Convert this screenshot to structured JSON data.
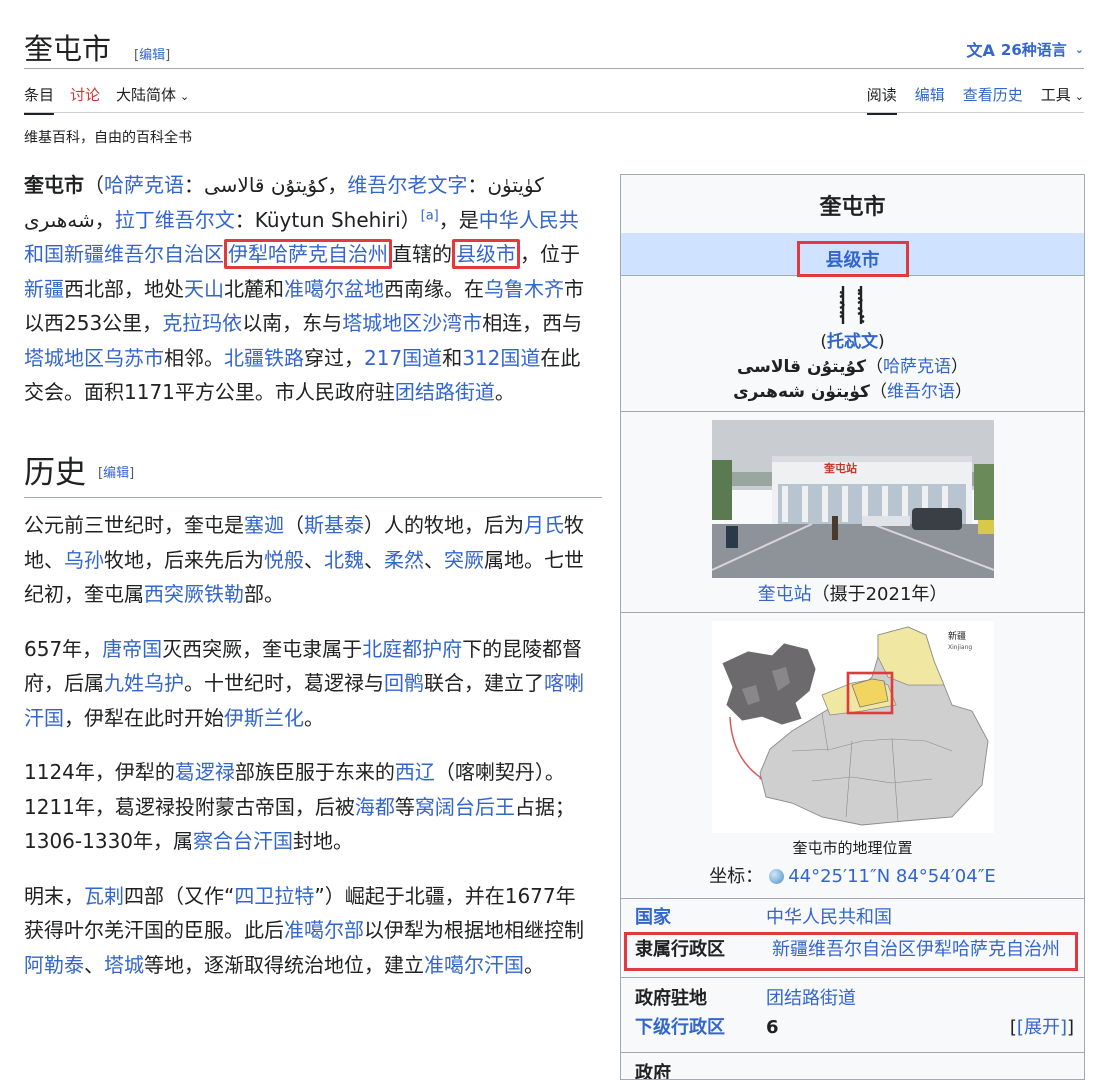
{
  "header": {
    "title": "奎屯市",
    "edit_label": "编辑",
    "languages_label": "26种语言",
    "lang_icon": "文A"
  },
  "tabs": {
    "article": "条目",
    "talk": "讨论",
    "variant": "大陆简体",
    "read": "阅读",
    "edit": "编辑",
    "history": "查看历史",
    "tools": "工具"
  },
  "tagline": "维基百科，自由的百科全书",
  "lead": {
    "name": "奎屯市",
    "lang1": "哈萨克语",
    "lang1_text": "كۇيتۇن قالاسى",
    "lang2": "维吾尔老文字",
    "lang2_text": "كۈيتۈن",
    "lang2_text_b": "شەھىرى",
    "lang3": "拉丁维吾尔文",
    "lang3_text": "Küytun Shehiri",
    "ref": "[a]",
    "link_prc_xinjiang": "中华人民共和国新疆维吾尔自治区",
    "link_ili": "伊犁哈萨克自治州",
    "text_direct": "直辖的",
    "link_county": "县级市",
    "text_located": "位于",
    "link_xinjiang": "新疆",
    "text_northwest": "西北部，地处",
    "link_tianshan": "天山",
    "text_north_foot": "北麓和",
    "link_junggar": "准噶尔盆地",
    "text_southwest": "西南缘。在",
    "link_urumqi": "乌鲁木齐",
    "text_west": "市以西253公里，",
    "link_karamay": "克拉玛依",
    "text_south": "以南，东与",
    "link_shawan": "塔城地区沙湾市",
    "text_adjacent": "相连，西与",
    "link_wusu": "塔城地区乌苏市",
    "text_neighbor": "相邻。",
    "link_beijiang_rail": "北疆铁路",
    "text_pass": "穿过，",
    "link_g217": "217国道",
    "text_and": "和",
    "link_g312": "312国道",
    "text_cross": "在此交会。面积1171平方公里。市人民政府驻",
    "link_tuanjie": "团结路街道",
    "text_end": "。"
  },
  "history": {
    "heading": "历史",
    "edit_label": "编辑",
    "p1": {
      "t1": "公元前三世纪时，奎屯是",
      "l1": "塞迦",
      "t2": "（",
      "l2": "斯基泰",
      "t3": "）人的牧地，后为",
      "l3": "月氏",
      "t4": "牧地、",
      "l4": "乌孙",
      "t5": "牧地，后来先后为",
      "l5": "悦般",
      "t6": "、",
      "l6": "北魏",
      "t7": "、",
      "l7": "柔然",
      "t8": "、",
      "l8": "突厥",
      "t9": "属地。七世纪初，奎屯属",
      "l9": "西突厥铁勒",
      "t10": "部。"
    },
    "p2": {
      "t1": "657年，",
      "l1": "唐帝国",
      "t2": "灭西突厥，奎屯隶属于",
      "l2": "北庭都护府",
      "t3": "下的昆陵都督府，后属",
      "l3": "九姓乌护",
      "t4": "。十世纪时，葛逻禄与",
      "l4": "回鹘",
      "t5": "联合，建立了",
      "l5": "喀喇汗国",
      "t6": "，伊犁在此时开始",
      "l6": "伊斯兰化",
      "t7": "。"
    },
    "p3": {
      "t1": "1124年，伊犁的",
      "l1": "葛逻禄",
      "t2": "部族臣服于东来的",
      "l2": "西辽",
      "t3": "（喀喇契丹）。1211年，葛逻禄投附蒙古帝国，后被",
      "l3": "海都",
      "t4": "等",
      "l4": "窝阔台后王",
      "t5": "占据；1306-1330年，属",
      "l5": "察合台汗国",
      "t6": "封地。"
    },
    "p4": {
      "t1": "明末，",
      "l1": "瓦剌",
      "t2": "四部（又作“",
      "l2": "四卫拉特",
      "t3": "”）崛起于北疆，并在1677年获得叶尔羌汗国的臣服。此后",
      "l3": "准噶尔部",
      "t4": "以伊犁为根据地相继控制",
      "l4": "阿勒泰",
      "t5": "、",
      "l5": "塔城",
      "t6": "等地，逐渐取得统治地位，建立",
      "l6": "准噶尔汗国",
      "t7": "。"
    }
  },
  "infobox": {
    "title": "奎屯市",
    "subtitle": "县级市",
    "todo_label": "托忒文",
    "kazakh_text": "كۇيتۇن قالاسى",
    "kazakh_link": "哈萨克语",
    "uyghur_text": "كۈيتۈن شەھىرى",
    "uyghur_link": "维吾尔语",
    "photo_sign": "奎屯站",
    "photo_caption_link": "奎屯站",
    "photo_caption_text": "（摄于2021年）",
    "map_label": "新疆",
    "map_label_en": "Xinjiang",
    "map_caption": "奎屯市的地理位置",
    "coords_label": "坐标：",
    "coords_value": "44°25′11″N 84°54′04″E",
    "rows": [
      {
        "label": "国家",
        "value": "中华人民共和国",
        "label_is_link": true
      },
      {
        "label": "隶属行政区",
        "value": "新疆维吾尔自治区伊犁哈萨克自治州",
        "label_is_link": false
      },
      {
        "label": "政府驻地",
        "value": "团结路街道",
        "label_is_link": false
      },
      {
        "label": "下级行政区",
        "value": "6",
        "expand": "[展开]",
        "label_is_link": true
      },
      {
        "label": "政府",
        "value": "",
        "label_is_link": false
      }
    ]
  },
  "colors": {
    "link": "#3366cc",
    "highlight_box": "#e0393e",
    "infobox_subtitle_bg": "#cfe2ff",
    "infobox_bg": "#f8f9fa",
    "talk_tab": "#d73333"
  }
}
